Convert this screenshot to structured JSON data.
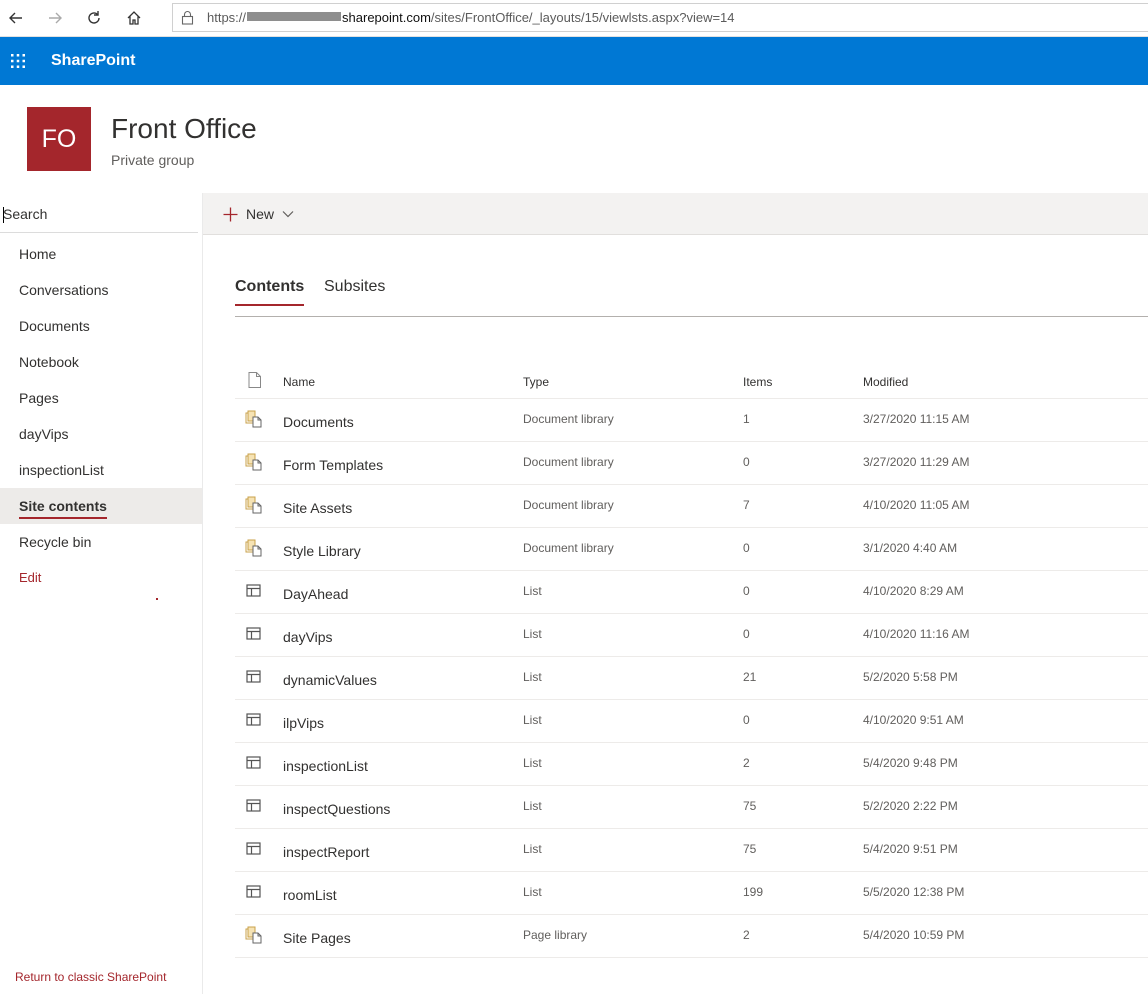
{
  "browser": {
    "url_prefix": "https://",
    "url_host": "sharepoint.com",
    "url_path": "/sites/FrontOffice/_layouts/15/viewlsts.aspx?view=14"
  },
  "suite": {
    "brand": "SharePoint"
  },
  "site": {
    "logo_text": "FO",
    "title": "Front Office",
    "subtitle": "Private group"
  },
  "search": {
    "placeholder": "Search"
  },
  "nav": {
    "items": [
      "Home",
      "Conversations",
      "Documents",
      "Notebook",
      "Pages",
      "dayVips",
      "inspectionList",
      "Site contents",
      "Recycle bin"
    ],
    "selected_index": 7,
    "edit_label": "Edit",
    "classic_label": "Return to classic SharePoint"
  },
  "command": {
    "new_label": "New"
  },
  "tabs": [
    "Contents",
    "Subsites"
  ],
  "table": {
    "headers": {
      "name": "Name",
      "type": "Type",
      "items": "Items",
      "modified": "Modified"
    },
    "rows": [
      {
        "icon": "document-library-icon",
        "name": "Documents",
        "type": "Document library",
        "items": "1",
        "modified": "3/27/2020 11:15 AM"
      },
      {
        "icon": "document-library-icon",
        "name": "Form Templates",
        "type": "Document library",
        "items": "0",
        "modified": "3/27/2020 11:29 AM"
      },
      {
        "icon": "document-library-icon",
        "name": "Site Assets",
        "type": "Document library",
        "items": "7",
        "modified": "4/10/2020 11:05 AM"
      },
      {
        "icon": "document-library-icon",
        "name": "Style Library",
        "type": "Document library",
        "items": "0",
        "modified": "3/1/2020 4:40 AM"
      },
      {
        "icon": "list-icon",
        "name": "DayAhead",
        "type": "List",
        "items": "0",
        "modified": "4/10/2020 8:29 AM"
      },
      {
        "icon": "list-icon",
        "name": "dayVips",
        "type": "List",
        "items": "0",
        "modified": "4/10/2020 11:16 AM"
      },
      {
        "icon": "list-icon",
        "name": "dynamicValues",
        "type": "List",
        "items": "21",
        "modified": "5/2/2020 5:58 PM"
      },
      {
        "icon": "list-icon",
        "name": "ilpVips",
        "type": "List",
        "items": "0",
        "modified": "4/10/2020 9:51 AM"
      },
      {
        "icon": "list-icon",
        "name": "inspectionList",
        "type": "List",
        "items": "2",
        "modified": "5/4/2020 9:48 PM"
      },
      {
        "icon": "list-icon",
        "name": "inspectQuestions",
        "type": "List",
        "items": "75",
        "modified": "5/2/2020 2:22 PM"
      },
      {
        "icon": "list-icon",
        "name": "inspectReport",
        "type": "List",
        "items": "75",
        "modified": "5/4/2020 9:51 PM"
      },
      {
        "icon": "list-icon",
        "name": "roomList",
        "type": "List",
        "items": "199",
        "modified": "5/5/2020 12:38 PM"
      },
      {
        "icon": "document-library-icon",
        "name": "Site Pages",
        "type": "Page library",
        "items": "2",
        "modified": "5/4/2020 10:59 PM"
      }
    ]
  },
  "colors": {
    "suite_blue": "#0078d4",
    "accent_red": "#a4262c",
    "nav_selected_bg": "#edebe9"
  }
}
